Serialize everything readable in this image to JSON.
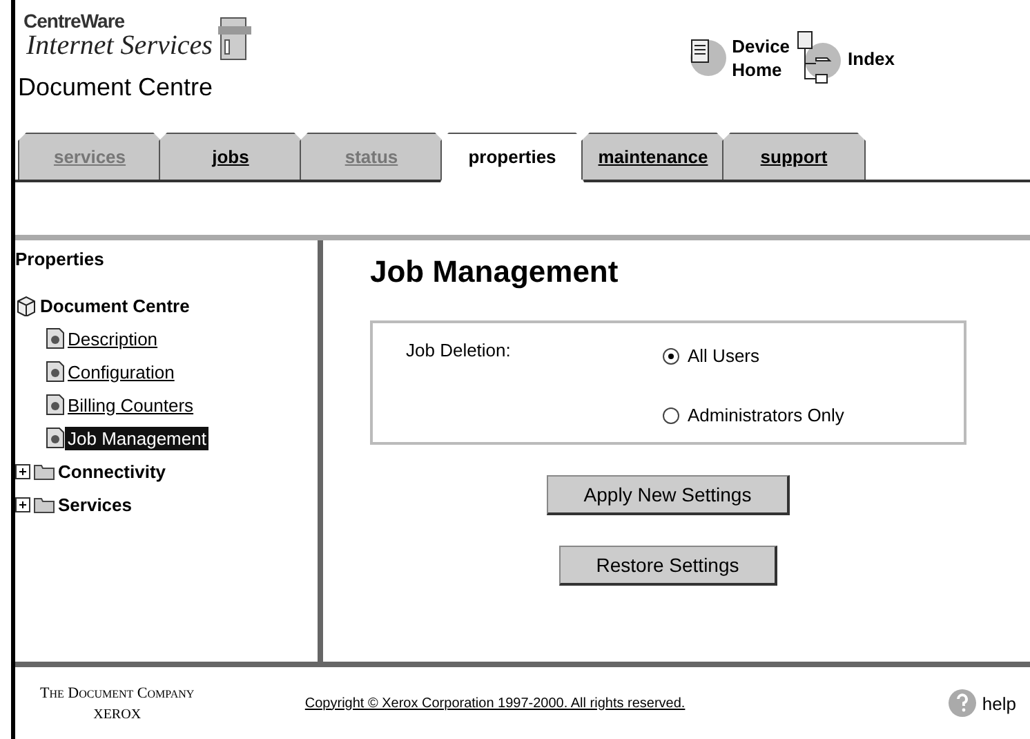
{
  "header": {
    "brand_top": "CentreWare",
    "brand_bottom": "Internet Services",
    "device_name": "Document Centre",
    "links": [
      {
        "kind": "home",
        "label_lines": [
          "Device",
          "Home"
        ]
      },
      {
        "kind": "index",
        "label_lines": [
          "Index"
        ]
      }
    ]
  },
  "tabs": [
    {
      "label": "services",
      "selected": false,
      "disabled": true
    },
    {
      "label": "jobs",
      "selected": false,
      "disabled": false
    },
    {
      "label": "status",
      "selected": false,
      "disabled": true
    },
    {
      "label": "properties",
      "selected": true,
      "disabled": false
    },
    {
      "label": "maintenance",
      "selected": false,
      "disabled": false
    },
    {
      "label": "support",
      "selected": false,
      "disabled": false
    }
  ],
  "sidebar": {
    "title": "Properties",
    "tree": [
      {
        "label": "Document Centre",
        "kind": "root",
        "children": [
          {
            "label": "Description",
            "kind": "page",
            "selected": false
          },
          {
            "label": "Configuration",
            "kind": "page",
            "selected": false
          },
          {
            "label": "Billing Counters",
            "kind": "page",
            "selected": false
          },
          {
            "label": "Job Management",
            "kind": "page",
            "selected": true
          }
        ]
      },
      {
        "label": "Connectivity",
        "kind": "folder",
        "expanded": false
      },
      {
        "label": "Services",
        "kind": "folder",
        "expanded": false
      }
    ]
  },
  "content": {
    "title": "Job Management",
    "setting": {
      "label": "Job Deletion:",
      "options": [
        {
          "label": "All Users",
          "selected": true
        },
        {
          "label": "Administrators Only",
          "selected": false
        }
      ]
    },
    "buttons": [
      "Apply New Settings",
      "Restore Settings"
    ]
  },
  "footer": {
    "company": "The Document Company",
    "brand": "XEROX",
    "copyright": "Copyright © Xerox Corporation 1997-2000. All rights reserved.",
    "help": "help"
  }
}
